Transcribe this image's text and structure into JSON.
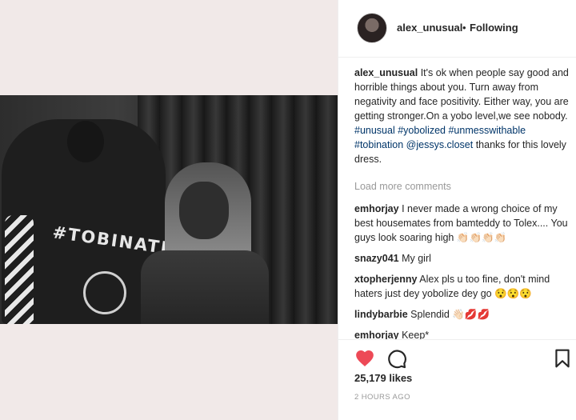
{
  "post": {
    "username": "alex_unusual",
    "separator": "•",
    "follow_status": "Following",
    "caption": {
      "username": "alex_unusual",
      "text": "It's ok when people say good and horrible things about you. Turn away from negativity and face positivity. Either way, you are getting stronger.On a yobo level,we see nobody.",
      "hashtags": [
        "#unusual",
        "#yobolized",
        "#unmesswithable",
        "#tobination"
      ],
      "mention": "@jessys.closet",
      "trailing_text": "thanks for this lovely dress."
    },
    "load_more_label": "Load more comments",
    "comments": [
      {
        "username": "emhorjay",
        "text": "I never made a wrong choice of my best housemates from bamteddy to Tolex.... You guys look soaring high",
        "emoji": "👏🏻👏🏻👏🏻👏🏻"
      },
      {
        "username": "snazy041",
        "text": "My girl",
        "emoji": ""
      },
      {
        "username": "xtopherjenny",
        "text": "Alex pls u too fine, don't mind haters just dey yobolize dey go",
        "emoji": "😯😯😯"
      },
      {
        "username": "lindybarbie",
        "text": "Splendid",
        "emoji": "👋🏻💋💋"
      },
      {
        "username": "emhorjay",
        "text": "Keep*",
        "emoji": ""
      }
    ],
    "likes_label": "25,179 likes",
    "time_label": "2 HOURS AGO"
  },
  "photo": {
    "jacket_print": "#TOBINATION"
  },
  "icons": {
    "like": "heart-icon",
    "comment": "comment-bubble-icon",
    "save": "bookmark-icon"
  },
  "colors": {
    "like": "#ed4956",
    "link": "#003569",
    "muted": "#999999",
    "background_left": "#f1e9e8"
  }
}
